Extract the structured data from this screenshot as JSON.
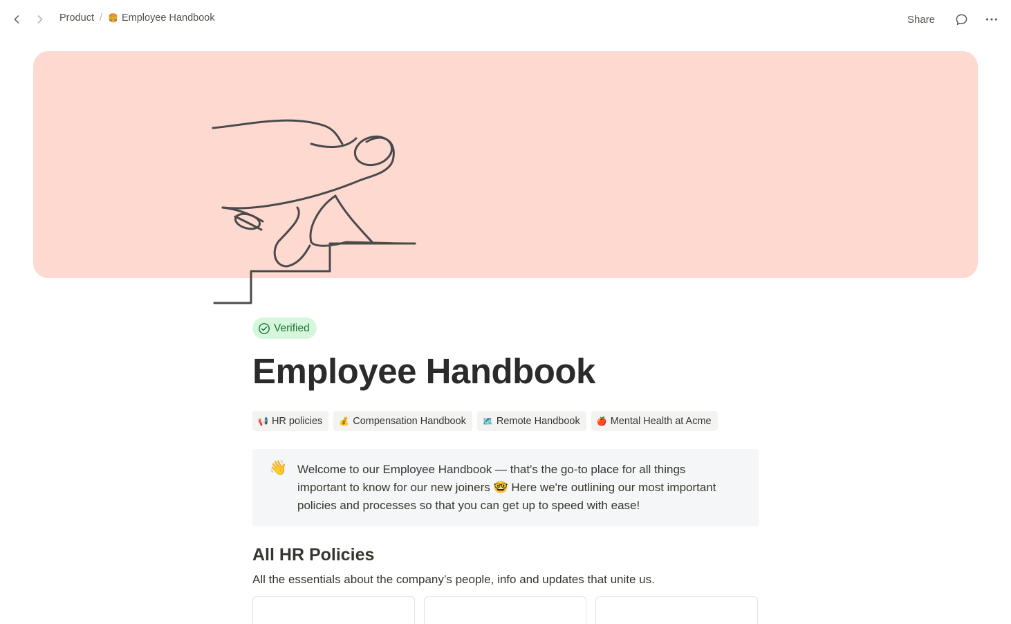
{
  "breadcrumb": {
    "parent": "Product",
    "separator": "/",
    "current_icon": "🍔",
    "current": "Employee Handbook"
  },
  "toolbar": {
    "share_label": "Share",
    "comment_icon": "comment-icon",
    "more_icon": "more-horizontal-icon"
  },
  "cover": {
    "color": "#fdd9cf",
    "illustration": "line-drawing-figure-on-stairs"
  },
  "badge": {
    "label": "Verified",
    "color": "#1f6f3a",
    "background": "#d6f7dc"
  },
  "page": {
    "title": "Employee Handbook"
  },
  "tags": [
    {
      "icon": "📢",
      "label": "HR policies"
    },
    {
      "icon": "💰",
      "label": "Compensation Handbook"
    },
    {
      "icon": "🗺️",
      "label": "Remote Handbook"
    },
    {
      "icon": "🍎",
      "label": "Mental Health at Acme"
    }
  ],
  "callout": {
    "emoji": "👋",
    "text": "Welcome to our Employee Handbook — that's the go-to place for all things important to know for our new joiners 🤓 Here we're outlining our most important policies and processes so that you can get up to speed with ease!"
  },
  "section": {
    "title": "All HR Policies",
    "subtitle": "All the essentials about the company’s people, info and updates that unite us."
  }
}
